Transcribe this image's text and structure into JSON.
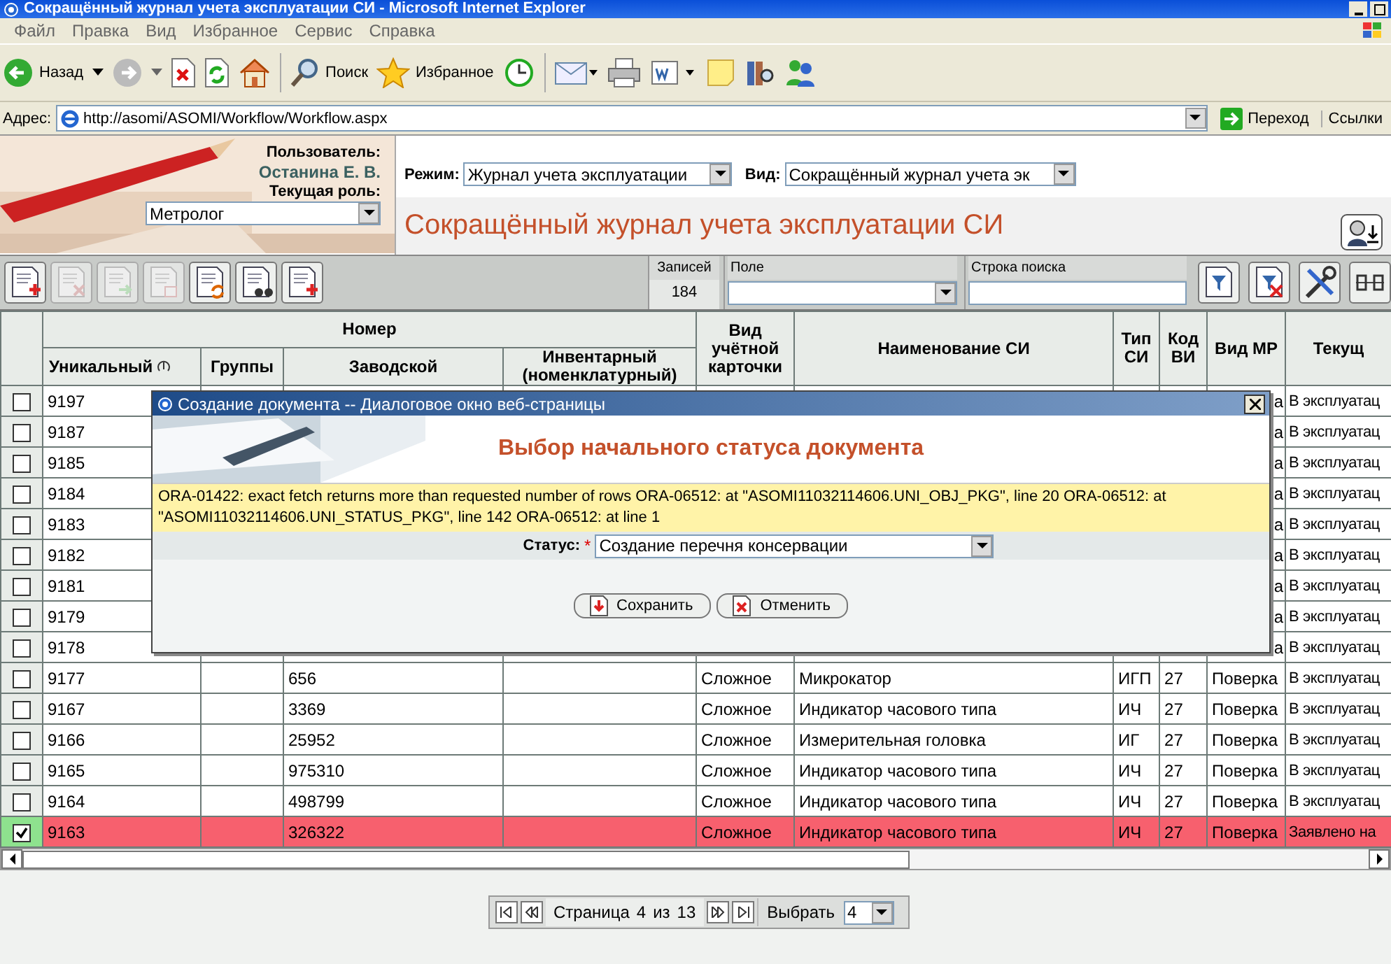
{
  "window": {
    "title": "Сокращённый журнал учета эксплуатации СИ - Microsoft Internet Explorer"
  },
  "menu": [
    "Файл",
    "Правка",
    "Вид",
    "Избранное",
    "Сервис",
    "Справка"
  ],
  "browser_toolbar": {
    "back": "Назад",
    "search": "Поиск",
    "favorites": "Избранное"
  },
  "address": {
    "label": "Адрес:",
    "url": "http://asomi/ASOMI/Workflow/Workflow.aspx",
    "go": "Переход",
    "links": "Ссылки"
  },
  "user_panel": {
    "user_label": "Пользователь:",
    "user_name": "Останина Е. В.",
    "role_label": "Текущая роль:",
    "role": "Метролог"
  },
  "filters": [
    {
      "label": "Режим:",
      "value": "Журнал учета эксплуатации"
    },
    {
      "label": "Вид:",
      "value": "Сокращённый журнал учета эк"
    }
  ],
  "page_title": "Сокращённый журнал учета эксплуатации СИ",
  "actions": [
    {
      "kind": "add",
      "disabled": false
    },
    {
      "kind": "delete",
      "disabled": true
    },
    {
      "kind": "move",
      "disabled": true
    },
    {
      "kind": "copy",
      "disabled": true
    },
    {
      "kind": "refresh",
      "disabled": false
    },
    {
      "kind": "find",
      "disabled": false
    },
    {
      "kind": "layout",
      "disabled": false
    }
  ],
  "records": {
    "label": "Записей",
    "count": "184"
  },
  "field_filter": {
    "label": "Поле"
  },
  "search": {
    "label": "Строка поиска"
  },
  "right_actions": [
    {
      "kind": "filter"
    },
    {
      "kind": "clear-filter"
    },
    {
      "kind": "tools"
    },
    {
      "kind": "export"
    }
  ],
  "table": {
    "group_header": "Номер",
    "columns": [
      "Уникальный",
      "Группы",
      "Заводской",
      "Инвентарный (номенклатурный)",
      "Вид учётной карточки",
      "Наименование СИ",
      "Тип СИ",
      "Код ВИ",
      "Вид МР",
      "Текущ"
    ],
    "rows": [
      {
        "checked": false,
        "selected": false,
        "unique": "9197",
        "mr_type": "а",
        "status": "В эксплуатац"
      },
      {
        "checked": false,
        "selected": false,
        "unique": "9187",
        "mr_type": "а",
        "status": "В эксплуатац"
      },
      {
        "checked": false,
        "selected": false,
        "unique": "9185",
        "mr_type": "а",
        "status": "В эксплуатац"
      },
      {
        "checked": false,
        "selected": false,
        "unique": "9184",
        "mr_type": "а",
        "status": "В эксплуатац"
      },
      {
        "checked": false,
        "selected": false,
        "unique": "9183",
        "mr_type": "а",
        "status": "В эксплуатац"
      },
      {
        "checked": false,
        "selected": false,
        "unique": "9182",
        "mr_type": "а",
        "status": "В эксплуатац"
      },
      {
        "checked": false,
        "selected": false,
        "unique": "9181",
        "mr_type": "а",
        "status": "В эксплуатац"
      },
      {
        "checked": false,
        "selected": false,
        "unique": "9179",
        "mr_type": "а",
        "status": "В эксплуатац"
      },
      {
        "checked": false,
        "selected": false,
        "unique": "9178",
        "mr_type": "а",
        "status": "В эксплуатац"
      },
      {
        "checked": false,
        "selected": false,
        "unique": "9177",
        "serial": "656",
        "card_type": "Сложное",
        "name": "Микрокатор",
        "si_type": "ИГП",
        "vi_code": "27",
        "mr_type": "Поверка",
        "status": "В эксплуатац"
      },
      {
        "checked": false,
        "selected": false,
        "unique": "9167",
        "serial": "3369",
        "card_type": "Сложное",
        "name": "Индикатор часового типа",
        "si_type": "ИЧ",
        "vi_code": "27",
        "mr_type": "Поверка",
        "status": "В эксплуатац"
      },
      {
        "checked": false,
        "selected": false,
        "unique": "9166",
        "serial": "25952",
        "card_type": "Сложное",
        "name": "Измерительная головка",
        "si_type": "ИГ",
        "vi_code": "27",
        "mr_type": "Поверка",
        "status": "В эксплуатац"
      },
      {
        "checked": false,
        "selected": false,
        "unique": "9165",
        "serial": "975310",
        "card_type": "Сложное",
        "name": "Индикатор часового типа",
        "si_type": "ИЧ",
        "vi_code": "27",
        "mr_type": "Поверка",
        "status": "В эксплуатац"
      },
      {
        "checked": false,
        "selected": false,
        "unique": "9164",
        "serial": "498799",
        "card_type": "Сложное",
        "name": "Индикатор часового типа",
        "si_type": "ИЧ",
        "vi_code": "27",
        "mr_type": "Поверка",
        "status": "В эксплуатац"
      },
      {
        "checked": true,
        "selected": true,
        "unique": "9163",
        "serial": "326322",
        "card_type": "Сложное",
        "name": "Индикатор часового типа",
        "si_type": "ИЧ",
        "vi_code": "27",
        "mr_type": "Поверка",
        "status": "Заявлено на"
      }
    ]
  },
  "dialog": {
    "title": "Создание документа -- Диалоговое окно веб-страницы",
    "heading": "Выбор начального статуса документа",
    "error": "ORA-01422: exact fetch returns more than requested number of rows ORA-06512: at \"ASOMI11032114606.UNI_OBJ_PKG\", line 20 ORA-06512: at \"ASOMI11032114606.UNI_STATUS_PKG\", line 142 ORA-06512: at line 1",
    "status_label": "Статус:",
    "required_mark": "*",
    "status_value": "Создание перечня консервации",
    "buttons": [
      "Сохранить",
      "Отменить"
    ]
  },
  "pager": {
    "label": "Страница",
    "page": "4",
    "of": "из",
    "total": "13",
    "select_label": "Выбрать",
    "select_value": "4"
  }
}
